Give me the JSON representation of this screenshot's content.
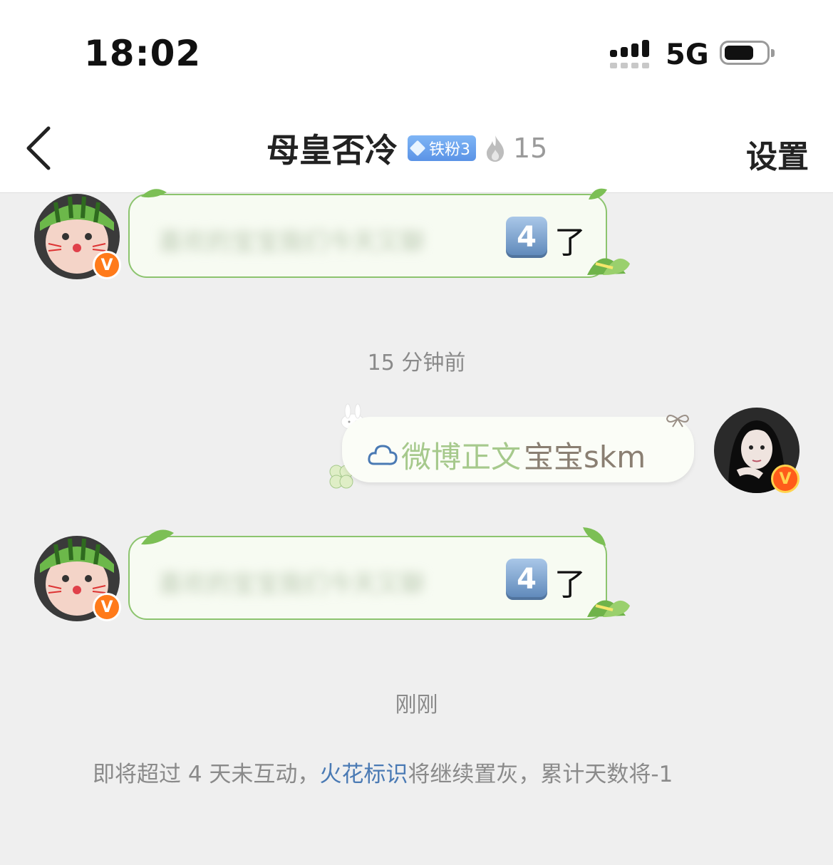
{
  "status_bar": {
    "time": "18:02",
    "network": "5G",
    "battery_level": 0.7
  },
  "header": {
    "title": "母皇否冷",
    "fan_badge": "铁粉3",
    "spark_count": "15",
    "settings_label": "设置"
  },
  "messages": [
    {
      "side": "left",
      "suffix_key": "4",
      "suffix_text": "了",
      "blurred_text": "喜欢的宝宝我们今天又聊"
    },
    {
      "side": "right",
      "link_text": "微博正文",
      "plain_text": "宝宝skm"
    },
    {
      "side": "left",
      "suffix_key": "4",
      "suffix_text": "了",
      "blurred_text": "喜欢的宝宝我们今天又聊"
    }
  ],
  "timestamps": {
    "first": "15 分钟前",
    "second": "刚刚"
  },
  "notice": {
    "part1": "即将超过 4 天未互动，",
    "highlight": "火花标识",
    "part2": "将继续置灰，累计天数将-1"
  },
  "colors": {
    "accent_blue": "#4a7ab4",
    "bubble_border_green": "#8cc46e",
    "badge_orange": "#ff7a1a"
  }
}
